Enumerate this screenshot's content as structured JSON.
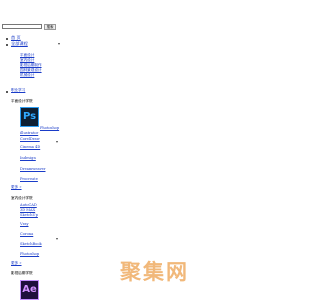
{
  "search": {
    "placeholder": "",
    "button_label": "搜索"
  },
  "nav": {
    "home": "首 页",
    "all_courses": "全部课程",
    "course_subs": [
      "平面设计",
      "室内设计",
      "影视后期制作",
      "园林景观设计",
      "机械设计"
    ],
    "learning_path": "职业学习"
  },
  "school_graphic": {
    "title": "平面设计学院",
    "icon_text": "Ps",
    "items": [
      "Photoshop",
      "illustrator",
      "CorelDraw",
      "Cinema 4D",
      "Indesign",
      "Dreamweaver",
      "Procreate"
    ],
    "more": "更多 »"
  },
  "school_interior": {
    "title": "室内设计学院",
    "items": [
      "AutoCAD",
      "3D MAX",
      "SketchUp",
      "Vray",
      "Corona",
      "SketchBook",
      "Photoshop"
    ],
    "more": "更多 »"
  },
  "school_video": {
    "title": "影视后期学院",
    "icon_text": "Ae"
  },
  "watermark": {
    "text": "聚集网"
  },
  "icons": [
    "photoshop-icon",
    "after-effects-icon",
    "dropdown-arrow-icon"
  ],
  "colors": {
    "link": "#1a3cc8",
    "watermark": "#f1b87a",
    "ps_bg": "#0d1f33",
    "ps_text": "#31a8ff",
    "ae_bg": "#1f0f3d",
    "ae_text": "#d291ff"
  }
}
